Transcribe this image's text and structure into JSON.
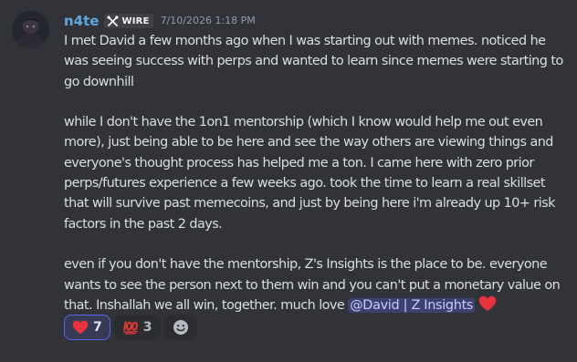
{
  "message": {
    "username": "n4te",
    "role_tag": "WIRE",
    "timestamp": "7/10/2026 1:18 PM",
    "paragraphs": [
      "I met David a few months ago when I was starting out with memes. noticed he was seeing success with perps and wanted to learn since memes were starting to go downhill",
      "while I don't have the 1on1 mentorship (which I know would help me out even more), just being able to be here and see the way others are viewing things and everyone's thought process has helped me a ton. I came here with zero prior perps/futures experience a few weeks ago. took the time to learn a real skillset that will survive past memecoins, and just by being here i'm already up 10+ risk factors in the past 2 days."
    ],
    "final_paragraph": "even if you don't have the mentorship, Z's Insights is the place to be. everyone wants to see the person next to them win and you can't put a monetary value on that. Inshallah we all win, together. much love ",
    "mention": "@David | Z Insights",
    "inline_emoji": "heart-icon"
  },
  "reactions": [
    {
      "emoji": "heart-icon",
      "count": "7",
      "active": true
    },
    {
      "emoji": "hundred-points-icon",
      "count": "3",
      "active": false
    }
  ],
  "add_reaction_icon": "smiley-add-reaction-icon",
  "colors": {
    "background": "#313338",
    "username": "#5fa6de",
    "text": "#dbdee1",
    "timestamp": "#949ba4",
    "mention_bg": "rgba(88,101,242,0.3)",
    "mention_text": "#c9cdfb",
    "active_reaction_border": "#5865f2",
    "heart": "#e8323c"
  }
}
